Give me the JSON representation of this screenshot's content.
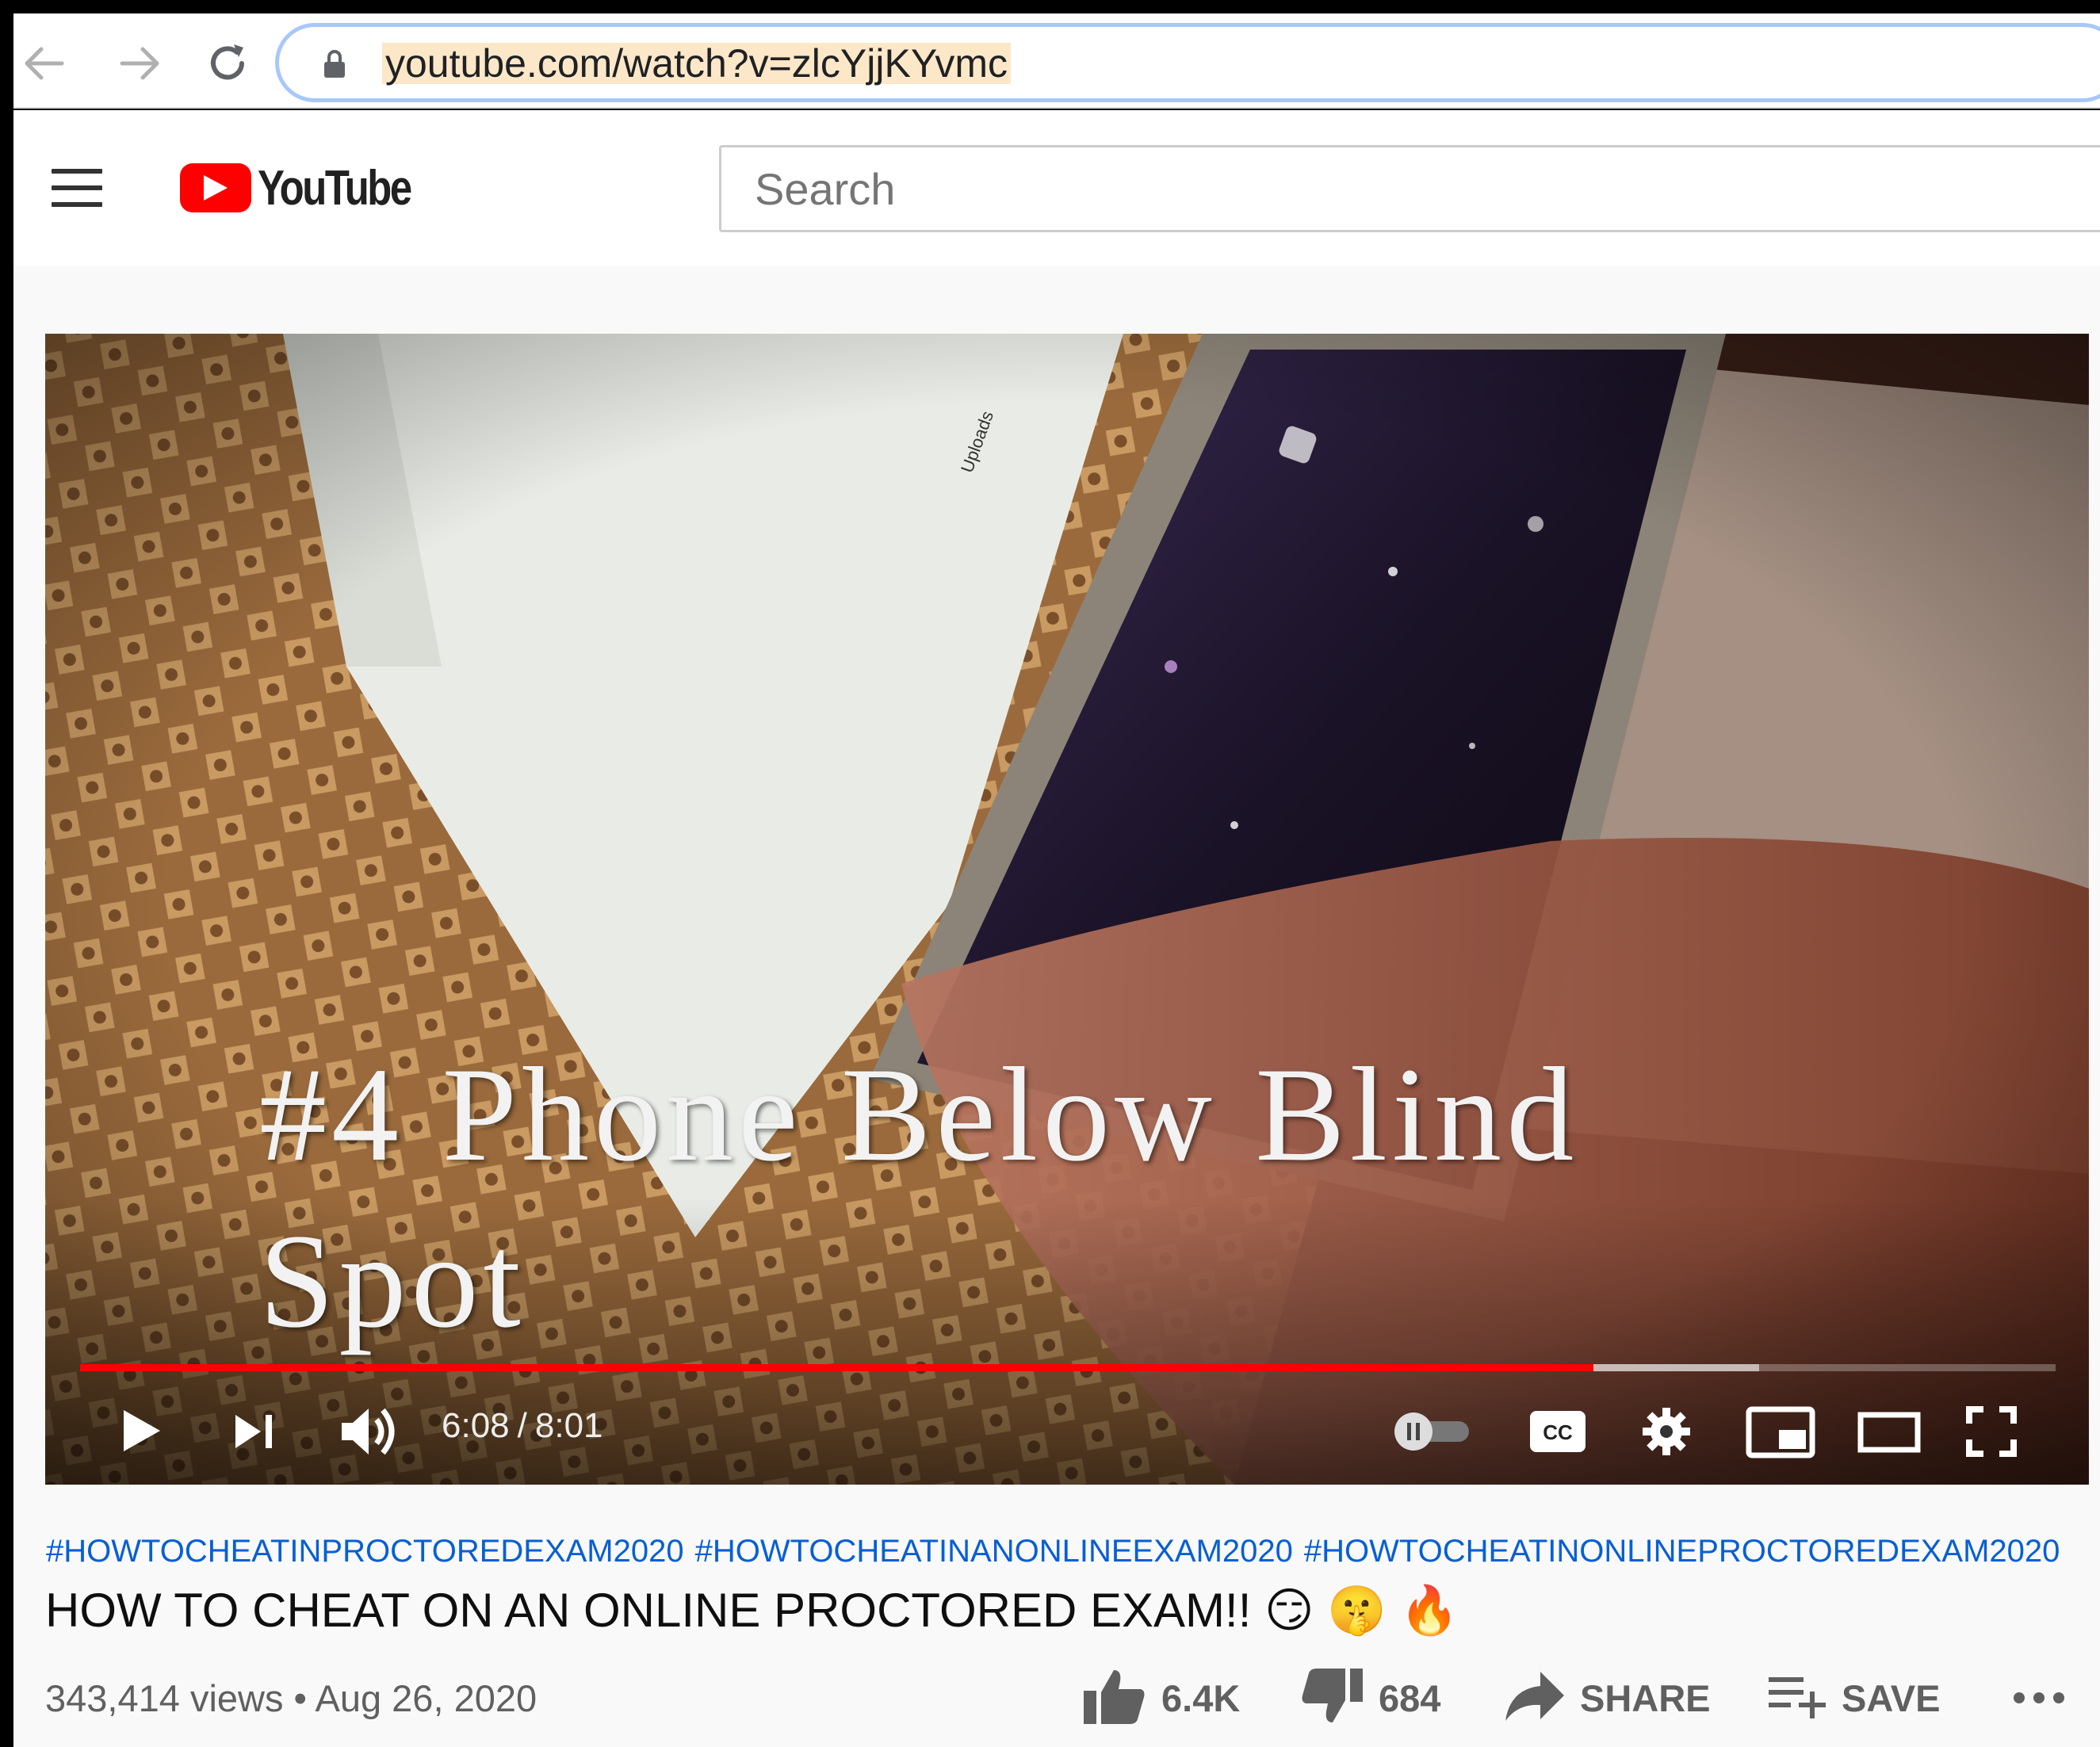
{
  "browser": {
    "url": "youtube.com/watch?v=zlcYjjKYvmc"
  },
  "header": {
    "logo_text": "YouTube",
    "search_placeholder": "Search"
  },
  "player": {
    "overlay_line1": "#4 Phone Below Blind",
    "overlay_line2": "Spot",
    "frame_label": "Uploads",
    "current_time": "6:08",
    "separator": "/",
    "duration": "8:01",
    "progress_fraction": 0.766,
    "buffered_fraction": 0.85
  },
  "video": {
    "hashtags": [
      "#HOWTOCHEATINPROCTOREDEXAM2020",
      "#HOWTOCHEATINANONLINEEXAM2020",
      "#HOWTOCHEATINONLINEPROCTOREDEXAM2020"
    ],
    "title": "HOW TO CHEAT ON AN ONLINE PROCTORED EXAM!! 😏 🤫 🔥",
    "views": "343,414 views",
    "bullet": "•",
    "date": "Aug 26, 2020",
    "likes": "6.4K",
    "dislikes": "684",
    "share_label": "SHARE",
    "save_label": "SAVE"
  },
  "colors": {
    "youtube_red": "#ff0000",
    "link_blue": "#065fd4",
    "address_highlight": "#fce8c8"
  }
}
